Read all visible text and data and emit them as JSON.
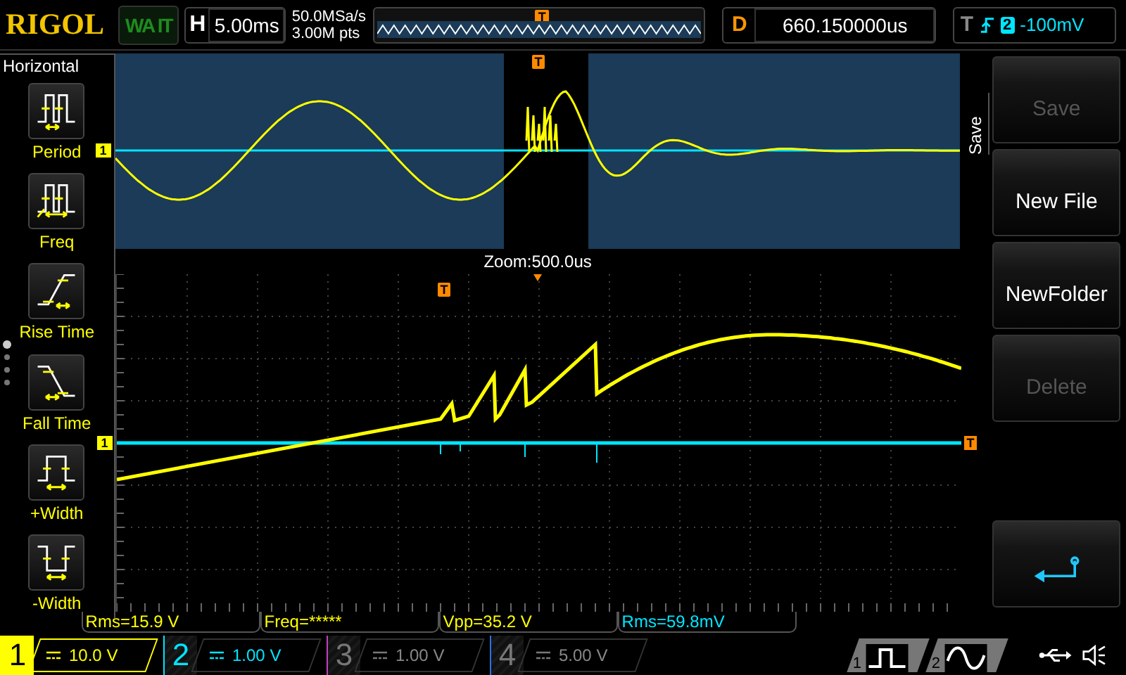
{
  "header": {
    "brand": "RIGOL",
    "run_status": "WA IT",
    "timebase": {
      "label": "H",
      "value": "5.00ms"
    },
    "sample_rate": "50.0MSa/s",
    "memory_depth": "3.00M pts",
    "memory_trigger_marker": "T",
    "delay": {
      "label": "D",
      "value": "660.150000us"
    },
    "trigger": {
      "label": "T",
      "source": "2",
      "level": "-100mV"
    }
  },
  "measure_menu": {
    "title": "Horizontal",
    "items": [
      {
        "label": "Period",
        "kind": "period"
      },
      {
        "label": "Freq",
        "kind": "freq"
      },
      {
        "label": "Rise Time",
        "kind": "rise"
      },
      {
        "label": "Fall Time",
        "kind": "fall"
      },
      {
        "label": "+Width",
        "kind": "pwidth"
      },
      {
        "label": "-Width",
        "kind": "nwidth"
      }
    ]
  },
  "zoom_window": {
    "channel_marker": "1",
    "trigger_marker": "T"
  },
  "zoom_label": "Zoom:500.0us",
  "main_window": {
    "trigger_marker": "T",
    "channel_marker": "1",
    "trigger_level_marker": "T"
  },
  "measurements": [
    {
      "text": "Rms=15.9 V",
      "color": "#ffff00"
    },
    {
      "text": "Freq=*****",
      "color": "#ffff00"
    },
    {
      "text": "Vpp=35.2 V",
      "color": "#ffff00"
    },
    {
      "text": "Rms=59.8mV",
      "color": "#00e5ff"
    }
  ],
  "channels": [
    {
      "number": "1",
      "scale": "10.0 V",
      "selected": true,
      "on": true,
      "color": "#ffff00"
    },
    {
      "number": "2",
      "scale": "1.00 V",
      "selected": false,
      "on": true,
      "color": "#00e5ff"
    },
    {
      "number": "3",
      "scale": "1.00 V",
      "selected": false,
      "on": false,
      "color": "#c040c0"
    },
    {
      "number": "4",
      "scale": "5.00 V",
      "selected": false,
      "on": false,
      "color": "#3070e0"
    }
  ],
  "sources": [
    {
      "number": "1",
      "kind": "square"
    },
    {
      "number": "2",
      "kind": "sine"
    }
  ],
  "softkey_menu": {
    "title": "Save",
    "buttons": [
      {
        "kind": "text",
        "label": "Save",
        "disabled": true
      },
      {
        "kind": "text",
        "label": "New File",
        "disabled": false
      },
      {
        "kind": "text",
        "label": "NewFolder",
        "disabled": false
      },
      {
        "kind": "text",
        "label": "Delete",
        "disabled": true
      },
      {
        "kind": "spacer"
      },
      {
        "kind": "return"
      }
    ]
  }
}
